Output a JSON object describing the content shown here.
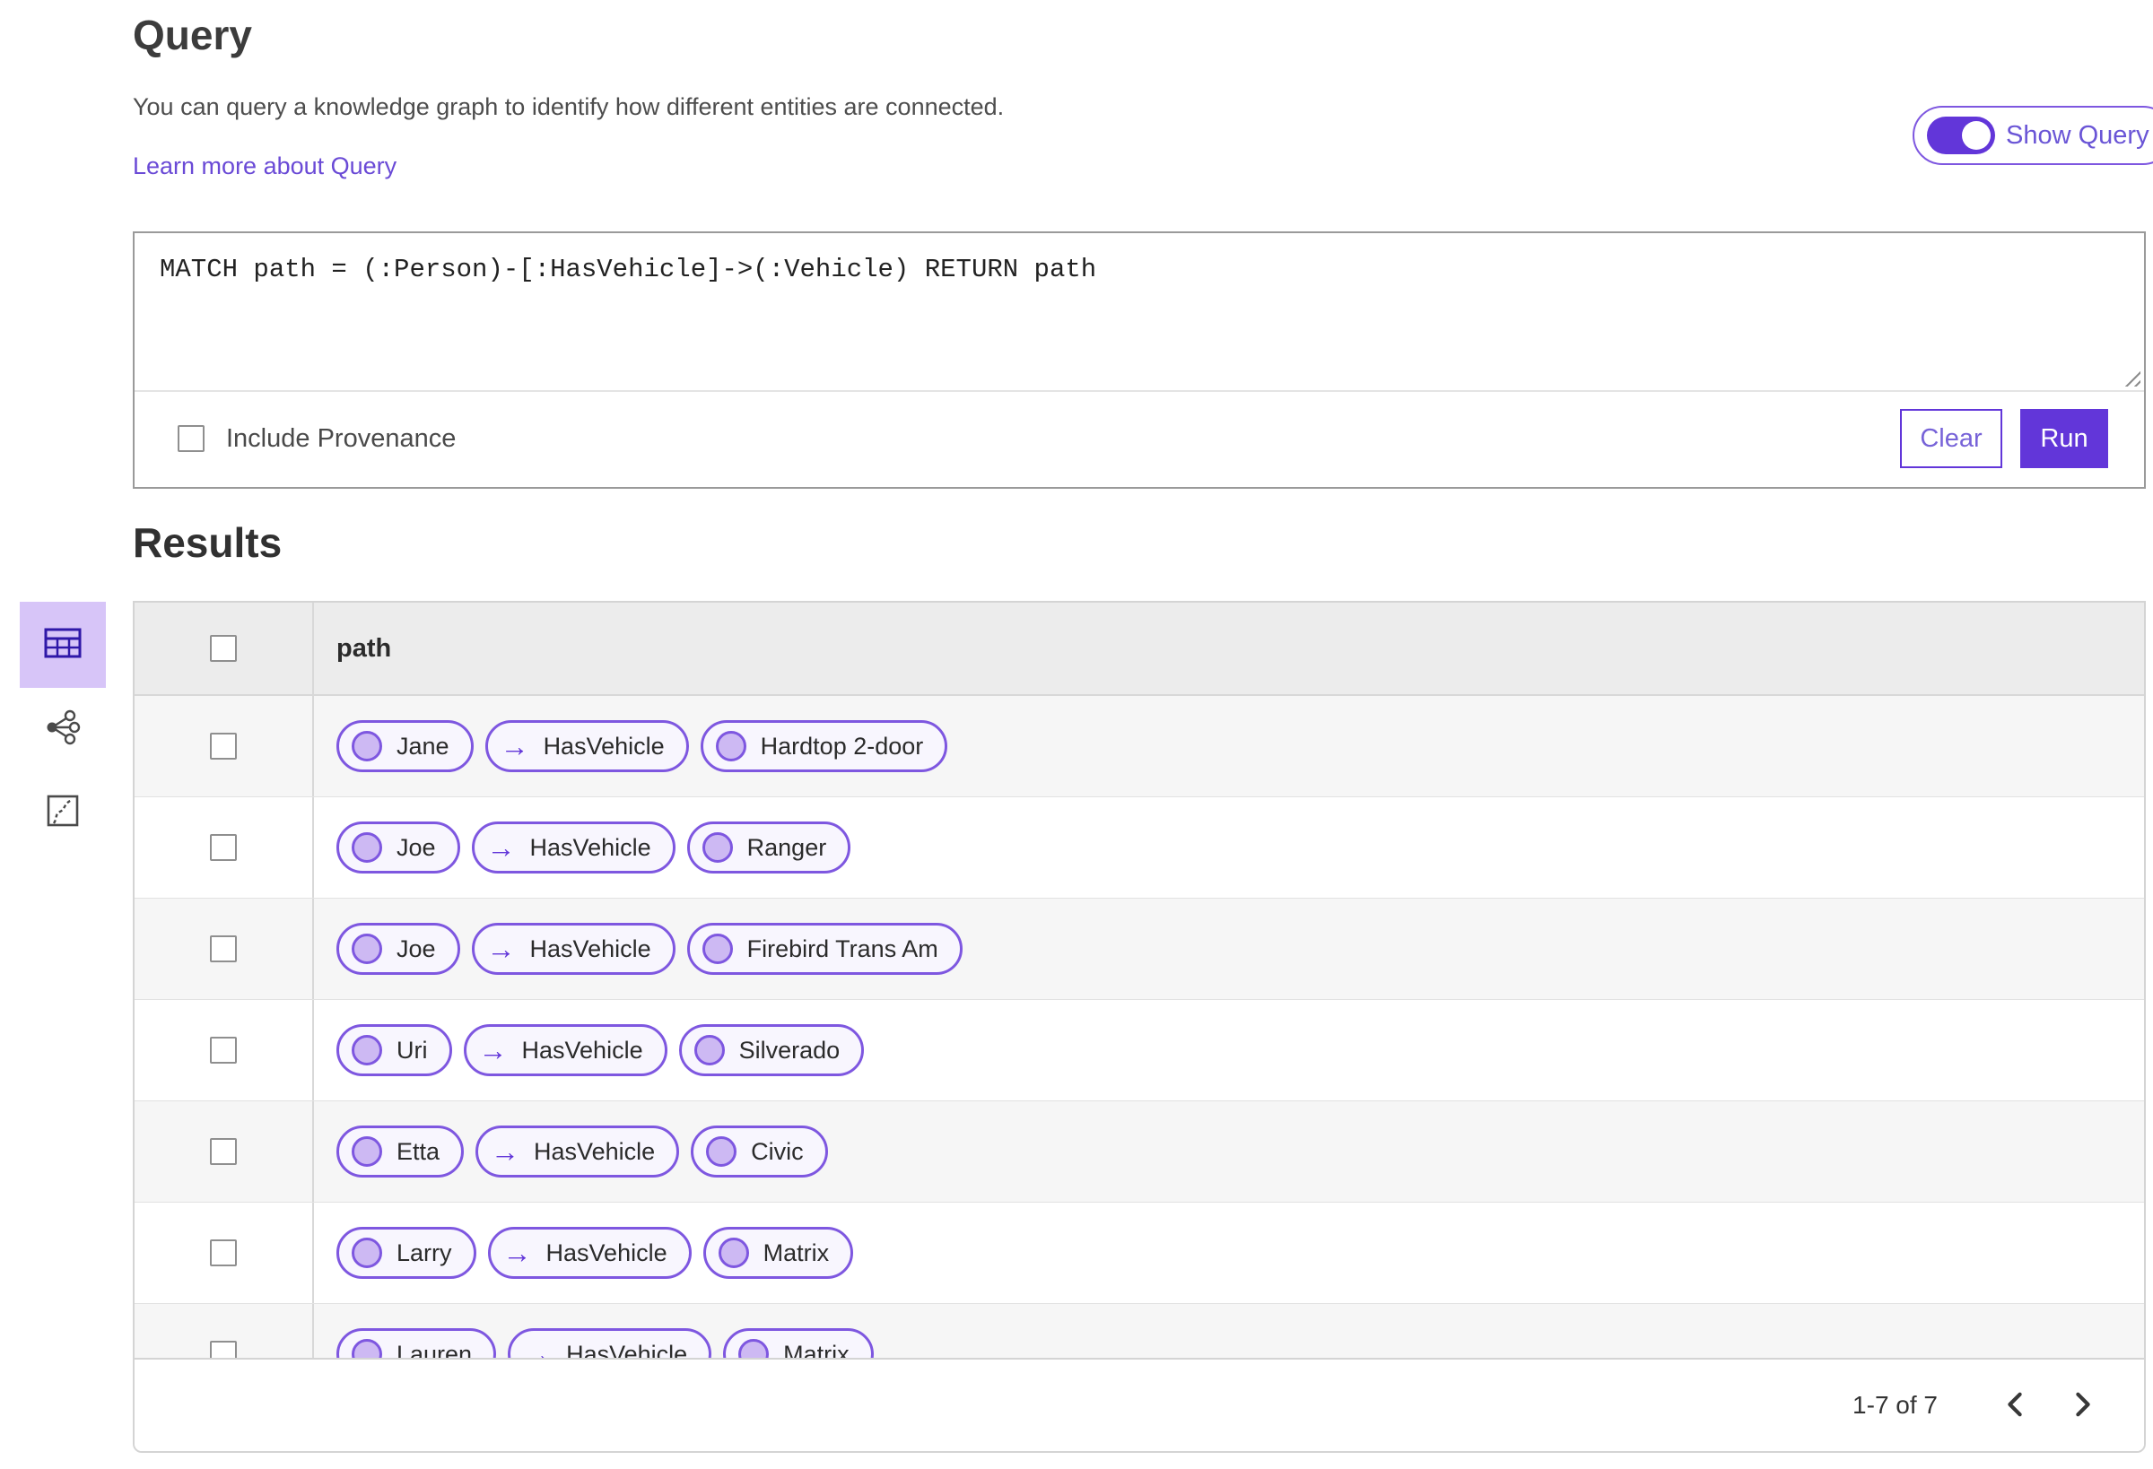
{
  "colors": {
    "accent_purple": "#6236d9",
    "pill_border_purple": "#7e57e0",
    "pill_background": "#f8f6fe",
    "selected_view_background": "#d7c5f8",
    "link_purple": "#6a4ad6"
  },
  "header": {
    "title": "Query",
    "description": "You can query a knowledge graph to identify how different entities are connected.",
    "learn_more_label": "Learn more about Query",
    "show_query_label": "Show Query",
    "show_query_on": true
  },
  "query_editor": {
    "query_text": "MATCH path = (:Person)-[:HasVehicle]->(:Vehicle) RETURN path",
    "include_provenance_label": "Include Provenance",
    "include_provenance_checked": false,
    "clear_label": "Clear",
    "run_label": "Run"
  },
  "results": {
    "title": "Results",
    "column_header": "path",
    "view_switcher": [
      {
        "name": "table-view",
        "selected": true
      },
      {
        "name": "link-chart-view",
        "selected": false
      },
      {
        "name": "map-view",
        "selected": false
      }
    ],
    "rows": [
      {
        "source": "Jane",
        "relationship": "HasVehicle",
        "target": "Hardtop 2-door"
      },
      {
        "source": "Joe",
        "relationship": "HasVehicle",
        "target": "Ranger"
      },
      {
        "source": "Joe",
        "relationship": "HasVehicle",
        "target": "Firebird Trans Am"
      },
      {
        "source": "Uri",
        "relationship": "HasVehicle",
        "target": "Silverado"
      },
      {
        "source": "Etta",
        "relationship": "HasVehicle",
        "target": "Civic"
      },
      {
        "source": "Larry",
        "relationship": "HasVehicle",
        "target": "Matrix"
      },
      {
        "source": "Lauren",
        "relationship": "HasVehicle",
        "target": "Matrix"
      }
    ],
    "pagination": {
      "range_label": "1-7 of 7"
    }
  },
  "icons": {
    "relationship_arrow": "→"
  }
}
